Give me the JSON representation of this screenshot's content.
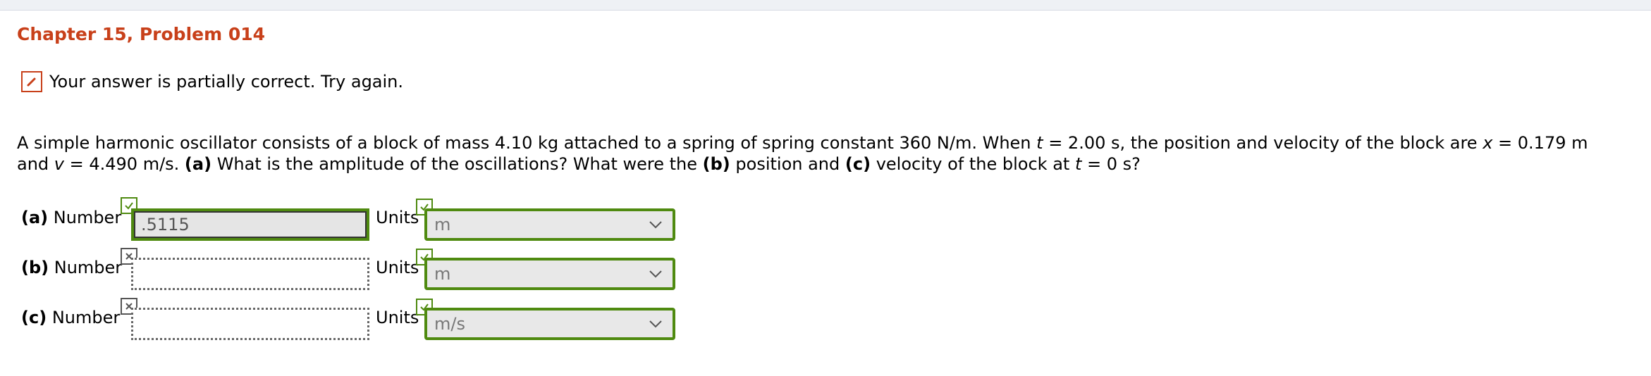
{
  "header": {
    "title": "Chapter 15, Problem 014"
  },
  "status": {
    "text": "Your answer is partially correct.  Try again.",
    "icon": "pencil-icon"
  },
  "problem": {
    "s1": "A simple harmonic oscillator consists of a block of mass 4.10 kg attached to a spring of spring constant 360 N/m. When ",
    "t1": "t",
    "s2": " = 2.00 s, the position and velocity of the block are ",
    "x": "x",
    "s3": " = 0.179 m",
    "s4": "and ",
    "v": "v",
    "s5": " = 4.490 m/s. ",
    "a": "(a)",
    "s6": " What is the amplitude of the oscillations? What were the ",
    "b": "(b)",
    "s7": " position and ",
    "c": "(c)",
    "s8": " velocity of the block at ",
    "t2": "t",
    "s9": " = 0 s?"
  },
  "parts": [
    {
      "part": "(a)",
      "number_label": "Number",
      "value": ".5115",
      "number_status": "correct",
      "units_label": "Units",
      "units": "m",
      "units_status": "correct"
    },
    {
      "part": "(b)",
      "number_label": "Number",
      "value": "",
      "number_status": "incorrect",
      "units_label": "Units",
      "units": "m",
      "units_status": "correct"
    },
    {
      "part": "(c)",
      "number_label": "Number",
      "value": "",
      "number_status": "incorrect",
      "units_label": "Units",
      "units": "m/s",
      "units_status": "correct"
    }
  ],
  "colors": {
    "title": "#c8401a",
    "correct": "#4f8a10",
    "incorrect": "#555555"
  }
}
